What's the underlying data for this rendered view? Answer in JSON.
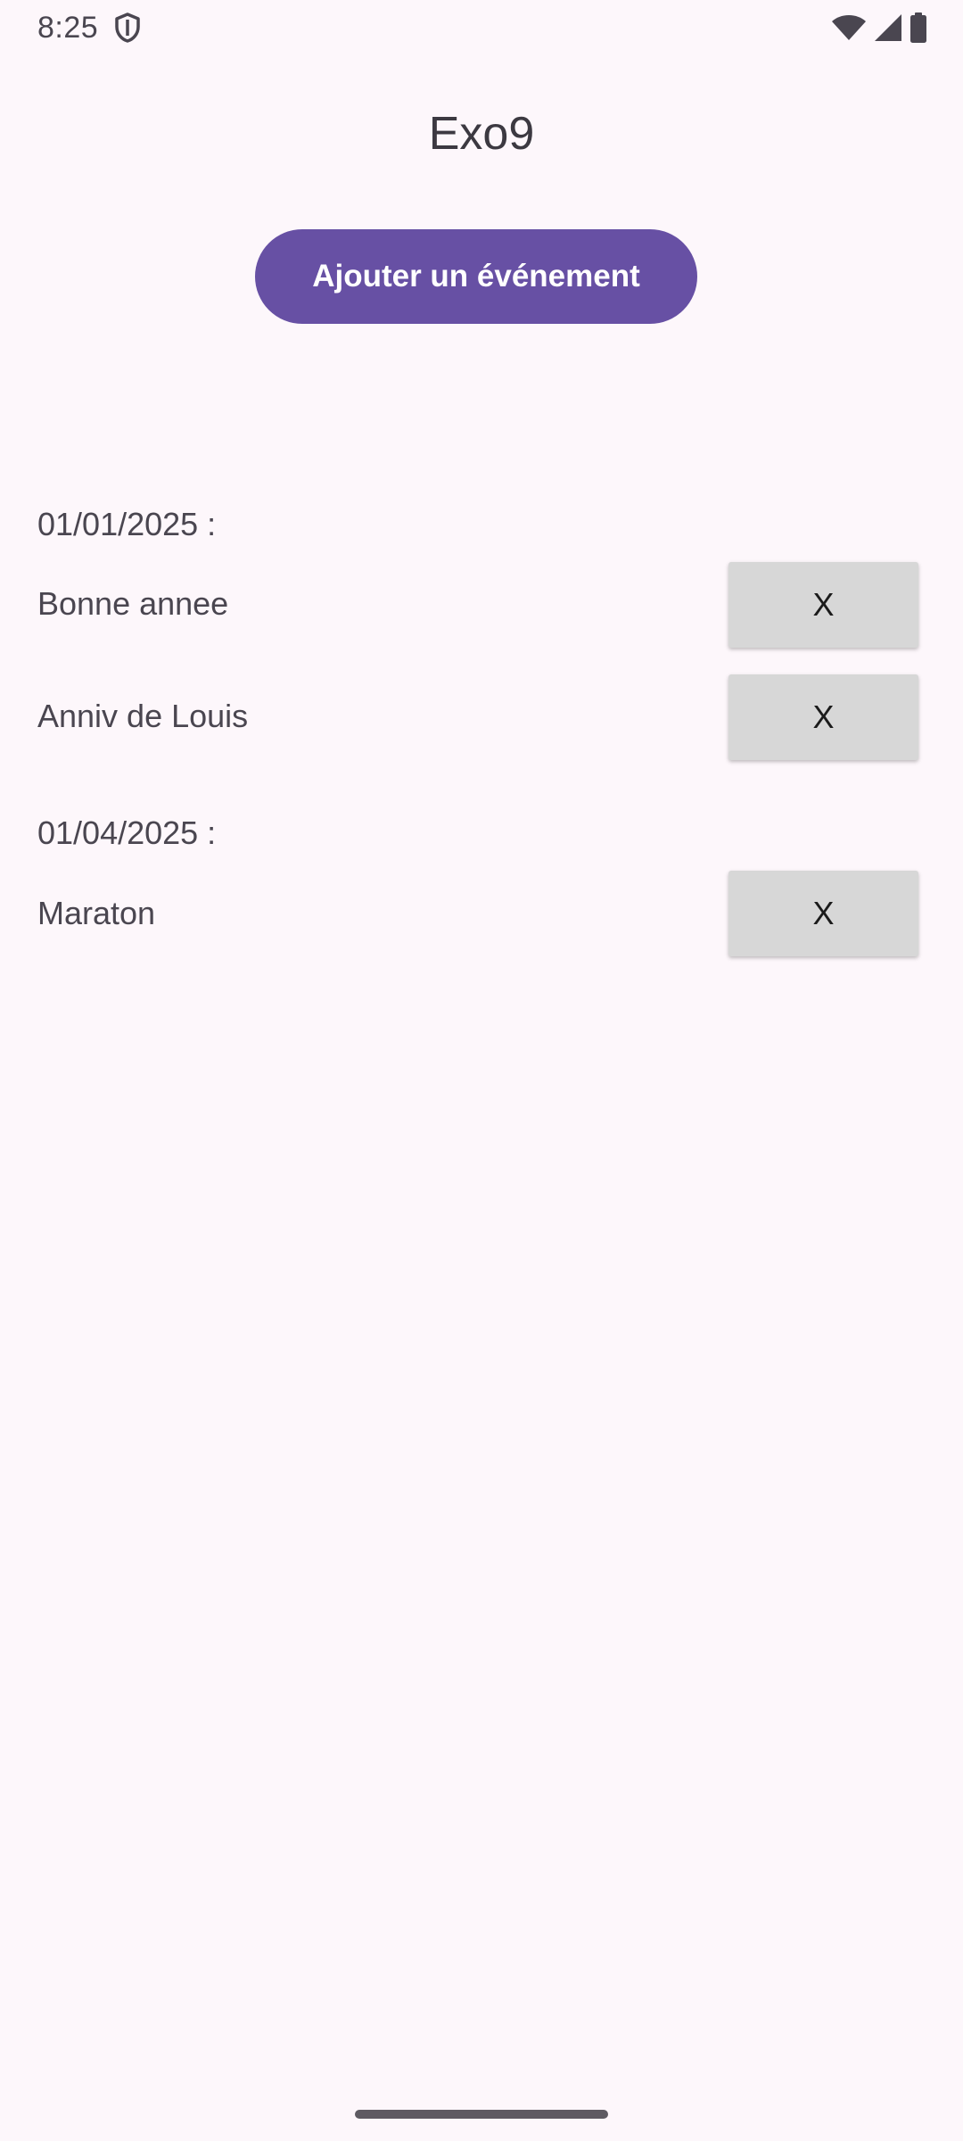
{
  "status_bar": {
    "time": "8:25",
    "left_icons": [
      "shield-icon"
    ],
    "right_icons": [
      "wifi-icon",
      "cellular-signal-icon",
      "battery-icon"
    ]
  },
  "app": {
    "title": "Exo9"
  },
  "actions": {
    "add_event_label": "Ajouter un événement"
  },
  "events": {
    "groups": [
      {
        "date": "01/01/2025 :",
        "items": [
          {
            "name": "Bonne annee",
            "delete_label": "X"
          },
          {
            "name": "Anniv de Louis",
            "delete_label": "X"
          }
        ]
      },
      {
        "date": "01/04/2025 :",
        "items": [
          {
            "name": "Maraton",
            "delete_label": "X"
          }
        ]
      }
    ]
  },
  "colors": {
    "background": "#fdf7fb",
    "primary": "#6750a4",
    "delete_button": "#d7d7d7",
    "text": "#4a4650"
  }
}
